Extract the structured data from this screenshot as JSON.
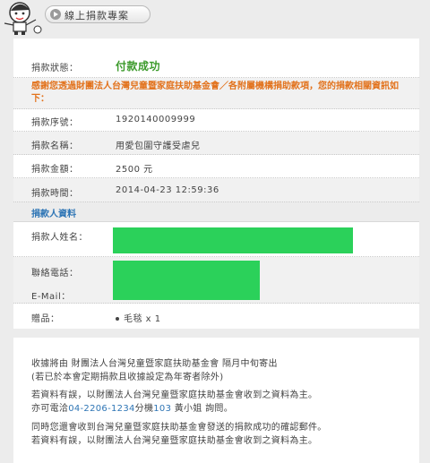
{
  "header": {
    "badge_label": "線上捐款專案"
  },
  "status": {
    "label": "捐款狀態：",
    "value": "付款成功"
  },
  "notice": "感謝您透過財團法人台灣兒童暨家庭扶助基金會／各附屬機構捐助款項，您的捐款相關資訊如下：",
  "donation": {
    "serial": {
      "label": "捐款序號：",
      "value": "1920140009999"
    },
    "name": {
      "label": "捐款名稱：",
      "value": "用愛包圍守護受虐兒"
    },
    "amount": {
      "label": "捐款金額：",
      "value": "2500 元"
    },
    "time": {
      "label": "捐款時間：",
      "value": "2014-04-23 12:59:36"
    }
  },
  "donor": {
    "section_title": "捐款人資料",
    "name_label": "捐款人姓名：",
    "phone_label": "聯絡電話：",
    "email_label": "E-Mail：",
    "gift_label": "贈品：",
    "gift_item": "毛毯 x 1"
  },
  "notes": {
    "line1": "收據將由 財團法人台灣兒童暨家庭扶助基金會 隔月中旬寄出",
    "line2": "(若已於本會定期捐款且收據設定為年寄者除外)",
    "line3": "若資料有誤，以財團法人台灣兒童暨家庭扶助基金會收到之資料為主。",
    "line4_prefix": "亦可電洽",
    "line4_phone": "04-2206-1234",
    "line4_mid": "分機",
    "line4_ext": "103",
    "line4_suffix": " 黃小姐 詢問。",
    "line5": "同時您還會收到台灣兒童暨家庭扶助基金會發送的捐款成功的確認郵件。",
    "line6": "若資料有誤，以財團法人台灣兒童暨家庭扶助基金會收到之資料為主。"
  },
  "colors": {
    "success": "#3c9a2b",
    "notice": "#e2721c",
    "section": "#2e75b5",
    "redaction": "#2bd15a"
  }
}
